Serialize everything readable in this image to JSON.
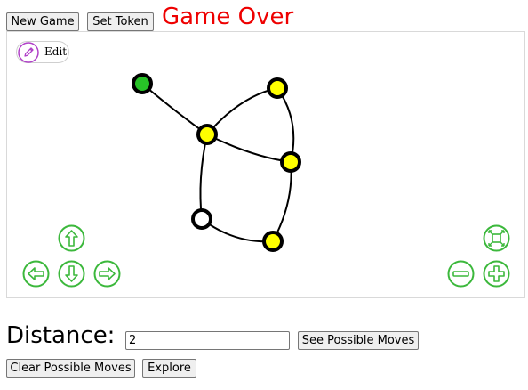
{
  "toolbar": {
    "new_game_label": "New Game",
    "set_token_label": "Set Token"
  },
  "status": {
    "text": "Game Over",
    "color": "#ee0000"
  },
  "editor": {
    "edit_label": "Edit",
    "accent": "#b040c8"
  },
  "graph": {
    "node_colors": {
      "green": "#27c227",
      "yellow": "#ffff00",
      "white": "#ffffff",
      "outline": "#000000"
    },
    "nodes": [
      {
        "id": "n-green",
        "color": "green"
      },
      {
        "id": "n-top-right",
        "color": "yellow"
      },
      {
        "id": "n-center",
        "color": "yellow"
      },
      {
        "id": "n-right",
        "color": "yellow"
      },
      {
        "id": "n-white",
        "color": "white"
      },
      {
        "id": "n-bottom",
        "color": "yellow"
      }
    ]
  },
  "controls": {
    "accent": "#3cb83c",
    "icons": [
      "pan-up-icon",
      "pan-left-icon",
      "pan-down-icon",
      "pan-right-icon",
      "fit-view-icon",
      "zoom-out-icon",
      "zoom-in-icon"
    ]
  },
  "distance": {
    "label": "Distance:",
    "value": "2",
    "see_moves_label": "See Possible Moves"
  },
  "bottom": {
    "clear_label": "Clear Possible Moves",
    "explore_label": "Explore"
  }
}
